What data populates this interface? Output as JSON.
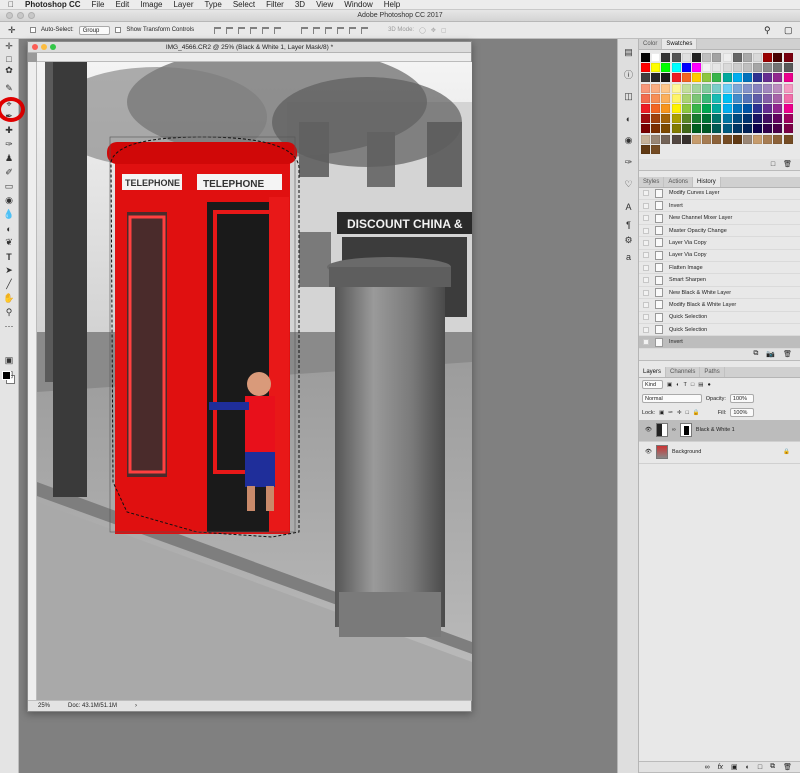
{
  "menubar": {
    "app": "Photoshop CC",
    "items": [
      "File",
      "Edit",
      "Image",
      "Layer",
      "Type",
      "Select",
      "Filter",
      "3D",
      "View",
      "Window",
      "Help"
    ]
  },
  "window": {
    "title": "Adobe Photoshop CC 2017"
  },
  "options": {
    "auto_select_label": "Auto-Select:",
    "auto_select_value": "Group",
    "transform_label": "Show Transform Controls",
    "mode_label": "3D Mode:"
  },
  "document": {
    "title": "IMG_4566.CR2 @ 25% (Black & White 1, Layer Mask/8) *",
    "zoom": "25%",
    "doc_size": "Doc: 43.1M/51.1M",
    "sign_top": "TELEPHONE",
    "sign_right": "TELEPHONE",
    "shop_sign": "DISCOUNT CHINA &"
  },
  "swatches_panel": {
    "tabs": [
      "Color",
      "Swatches"
    ],
    "active": "Swatches",
    "colors": [
      "#000000",
      "#ffffff",
      "#333333",
      "#555555",
      "#e0e0e0",
      "#222222",
      "#bfbfbf",
      "#a3a3a3",
      "#eeeeee",
      "#666666",
      "#aaaaaa",
      "#d9d9d9",
      "#9a0000",
      "#4a0000",
      "#7a0010",
      "#ff0000",
      "#ffff00",
      "#00ff00",
      "#00ffff",
      "#0000ff",
      "#ff00ff",
      "#f2f2f2",
      "#e6e6e6",
      "#d9d9d9",
      "#cccccc",
      "#bfbfbf",
      "#a6a6a6",
      "#8c8c8c",
      "#737373",
      "#595959",
      "#404040",
      "#262626",
      "#1a1a1a",
      "#ed1c24",
      "#f26522",
      "#ffcc00",
      "#8dc63f",
      "#39b54a",
      "#00a99d",
      "#00aeef",
      "#0072bc",
      "#2e3192",
      "#662d91",
      "#92278f",
      "#ec008c",
      "#f7977a",
      "#f9ad81",
      "#fdc68a",
      "#fff79a",
      "#c4df9b",
      "#a3d39c",
      "#82ca9d",
      "#7bcdc8",
      "#6ecff6",
      "#7ea7d8",
      "#8493ca",
      "#8882be",
      "#a187be",
      "#bc8dbf",
      "#f49ac2",
      "#f26c4f",
      "#f68e55",
      "#fbaf5c",
      "#fff467",
      "#acd372",
      "#7cc576",
      "#3bb878",
      "#1abbb4",
      "#00bff3",
      "#438ccb",
      "#5574b9",
      "#605ca8",
      "#855fa8",
      "#a763a8",
      "#f06eaa",
      "#ed1c24",
      "#f26522",
      "#f7941d",
      "#fff200",
      "#8dc73f",
      "#39b54a",
      "#00a651",
      "#00a99d",
      "#00aeef",
      "#0072bc",
      "#0054a6",
      "#2e3192",
      "#662d91",
      "#92278f",
      "#ec008c",
      "#9e0b0f",
      "#a0410d",
      "#a36209",
      "#aba000",
      "#598527",
      "#197b30",
      "#007236",
      "#00746b",
      "#0076a3",
      "#004b80",
      "#003471",
      "#1b1464",
      "#440e62",
      "#630460",
      "#9e005d",
      "#790000",
      "#7b2e00",
      "#7d4900",
      "#827b00",
      "#406618",
      "#005e20",
      "#005826",
      "#005952",
      "#005b7f",
      "#003663",
      "#002157",
      "#0d004c",
      "#32004b",
      "#4b0049",
      "#7b0046",
      "#c7b299",
      "#998675",
      "#736357",
      "#534741",
      "#37302d",
      "#c69c6d",
      "#a67c52",
      "#8c6239",
      "#754c24",
      "#603913",
      "#998675",
      "#c69c6d",
      "#a67c52",
      "#8c6239",
      "#754c24",
      "#603913",
      "#754c24"
    ]
  },
  "history_panel": {
    "tabs": [
      "Styles",
      "Actions",
      "History"
    ],
    "active": "History",
    "items": [
      "Modify Curves Layer",
      "Invert",
      "New Channel Mixer Layer",
      "Master Opacity Change",
      "Layer Via Copy",
      "Layer Via Copy",
      "Flatten Image",
      "Smart Sharpen",
      "New Black & White Layer",
      "Modify Black & White Layer",
      "Quick Selection",
      "Quick Selection",
      "Invert"
    ],
    "active_item": 12
  },
  "layers_panel": {
    "tabs": [
      "Layers",
      "Channels",
      "Paths"
    ],
    "active": "Layers",
    "filter": "Kind",
    "blend_mode": "Normal",
    "opacity_label": "Opacity:",
    "opacity": "100%",
    "lock_label": "Lock:",
    "fill_label": "Fill:",
    "fill": "100%",
    "layers": [
      {
        "name": "Black & White 1",
        "active": true
      },
      {
        "name": "Background",
        "active": false
      }
    ]
  }
}
